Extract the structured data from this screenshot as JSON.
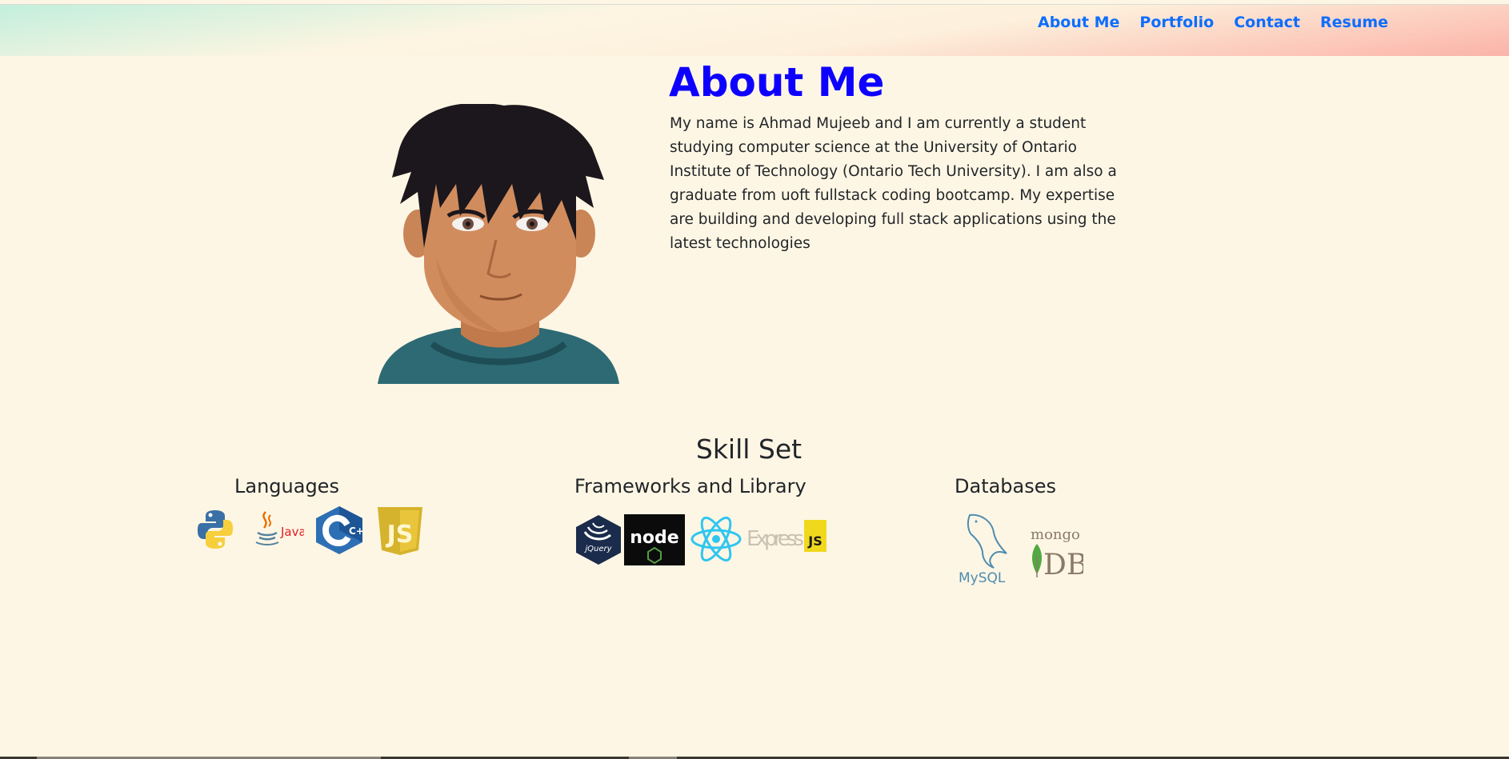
{
  "nav": {
    "links": [
      {
        "label": "About Me"
      },
      {
        "label": "Portfolio"
      },
      {
        "label": "Contact"
      },
      {
        "label": "Resume"
      }
    ]
  },
  "about": {
    "title": "About Me",
    "text": "My name is Ahmad Mujeeb and I am currently a student studying computer science at the University of Ontario Institute of Technology (Ontario Tech University). I am also a graduate from uoft fullstack coding bootcamp. My expertise are building and developing full stack applications using the latest technologies"
  },
  "skills": {
    "title": "Skill Set",
    "languages": {
      "title": "Languages",
      "icons": [
        "python-icon",
        "java-icon",
        "cplusplus-icon",
        "javascript-icon"
      ],
      "java_text": "Java",
      "cpp_text": "C++",
      "js_text": "JS"
    },
    "frameworks": {
      "title": "Frameworks and Library",
      "icons": [
        "jquery-icon",
        "nodejs-icon",
        "react-icon",
        "expressjs-icon"
      ],
      "jquery_text": "jQuery",
      "node_text": "node",
      "express_text": "Express",
      "express_js_text": "JS"
    },
    "databases": {
      "title": "Databases",
      "icons": [
        "mysql-icon",
        "mongodb-icon"
      ],
      "mysql_text": "MySQL",
      "mongo_text": "mongo",
      "db_text": "DB"
    }
  },
  "colors": {
    "background": "#fef6e4",
    "nav_link": "#0d6efd",
    "about_title": "#0d00ff"
  }
}
